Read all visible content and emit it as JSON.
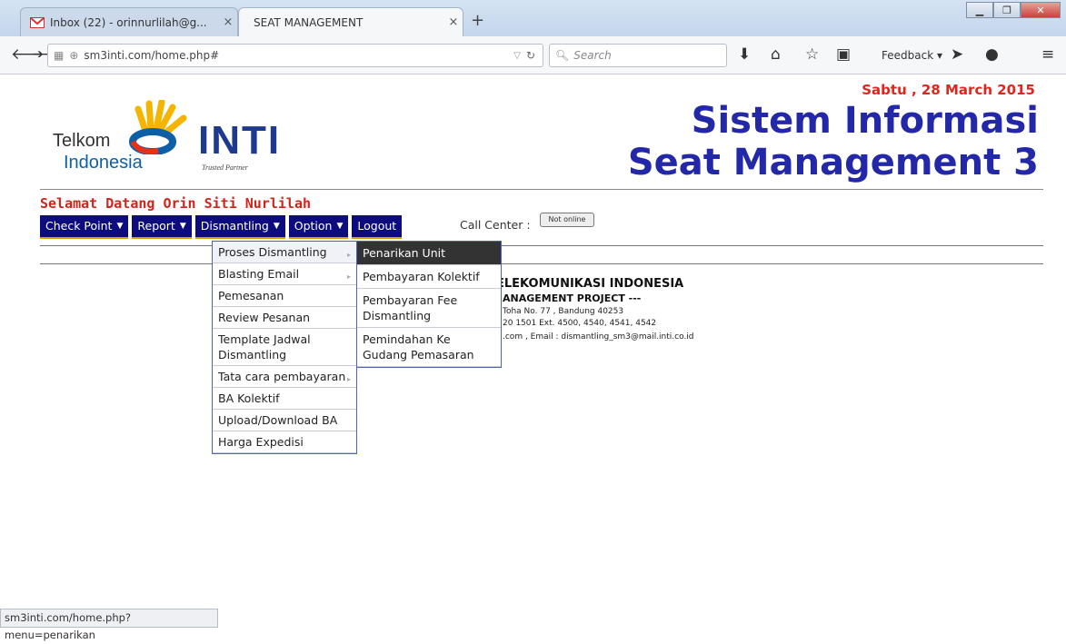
{
  "browser": {
    "tabs": [
      {
        "title": "Inbox (22) - orinnurlilah@g...",
        "active": false
      },
      {
        "title": "SEAT MANAGEMENT",
        "active": true
      }
    ],
    "url": "sm3inti.com/home.php#",
    "search_placeholder": "Search",
    "feedback_label": "Feedback",
    "status_url": "sm3inti.com/home.php?menu=penarikan"
  },
  "header": {
    "date": "Sabtu , 28 March 2015",
    "telkom_line1": "Telkom",
    "telkom_line2": "Indonesia",
    "inti_logo": "INTI",
    "inti_tagline": "Trusted Partner",
    "system_title_1": "Sistem Informasi",
    "system_title_2": "Seat Management 3"
  },
  "welcome": "Selamat Datang Orin Siti Nurlilah",
  "menu": [
    {
      "label": "Check Point",
      "caret": "▼"
    },
    {
      "label": "Report",
      "caret": "▼"
    },
    {
      "label": "Dismantling",
      "caret": "▼"
    },
    {
      "label": "Option",
      "caret": "▼"
    },
    {
      "label": "Logout",
      "caret": ""
    }
  ],
  "call_center": {
    "label": "Call Center :",
    "status": "Not online"
  },
  "dismantling_menu": [
    "Proses Dismantling",
    "Blasting Email",
    "Pemesanan",
    "Review Pesanan",
    "Template Jadwal Dismantling",
    "Tata cara pembayaran",
    "BA Kolektif",
    "Upload/Download BA",
    "Harga Expedisi"
  ],
  "proses_submenu": [
    "Penarikan Unit",
    "Pembayaran Kolektif",
    "Pembayaran Fee Dismantling",
    "Pemindahan Ke Gudang Pemasaran"
  ],
  "company": {
    "name": "ELEKOMUNIKASI INDONESIA",
    "project": "ANAGEMENT PROJECT ---",
    "address": "Toha No. 77 ,  Bandung 40253",
    "phone": "20 1501   Ext. 4500, 4540, 4541, 4542",
    "email": ".com ,   Email : dismantling_sm3@mail.inti.co.id"
  },
  "colors": {
    "menu_bg": "#0c0c7e",
    "title_blue": "#2228a8",
    "red": "#e0261c"
  }
}
